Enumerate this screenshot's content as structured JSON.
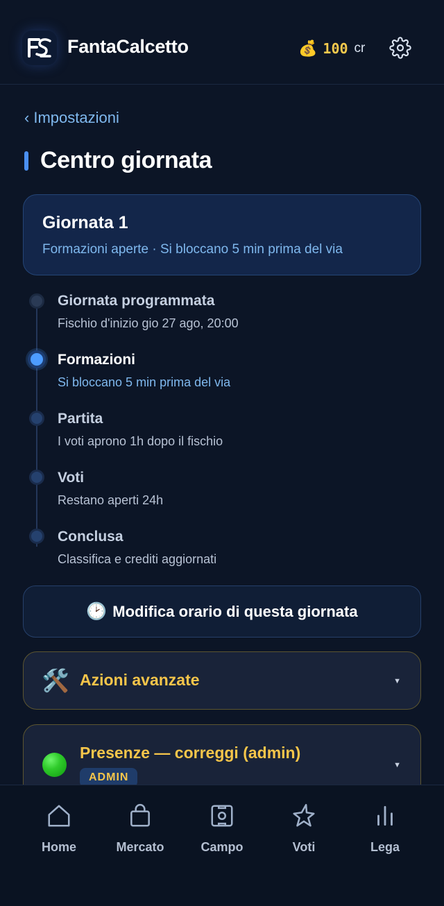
{
  "header": {
    "app_title": "FantaCalcetto",
    "credits_icon": "money-bag-icon",
    "credits_amount": "100",
    "credits_unit": "cr",
    "settings_icon": "gear-icon"
  },
  "breadcrumb": {
    "back_label": "Impostazioni"
  },
  "page": {
    "title": "Centro giornata"
  },
  "round": {
    "name": "Giornata 1",
    "status": "Formazioni aperte · Si bloccano 5 min prima del via"
  },
  "timeline": [
    {
      "label": "Giornata programmata",
      "sub": "Fischio d'inizio gio 27 ago, 20:00",
      "state": "done"
    },
    {
      "label": "Formazioni",
      "sub": "Si bloccano 5 min prima del via",
      "state": "active"
    },
    {
      "label": "Partita",
      "sub": "I voti aprono 1h dopo il fischio",
      "state": "pending"
    },
    {
      "label": "Voti",
      "sub": "Restano aperti 24h",
      "state": "pending"
    },
    {
      "label": "Conclusa",
      "sub": "Classifica e crediti aggiornati",
      "state": "pending"
    }
  ],
  "actions": {
    "edit_time_label": "Modifica orario di questa giornata",
    "advanced_label": "Azioni avanzate",
    "presence_label": "Presenze — correggi (admin)",
    "admin_badge": "ADMIN"
  },
  "nav": [
    {
      "label": "Home",
      "icon": "home-icon"
    },
    {
      "label": "Mercato",
      "icon": "shopping-bag-icon"
    },
    {
      "label": "Campo",
      "icon": "pitch-icon"
    },
    {
      "label": "Voti",
      "icon": "star-icon"
    },
    {
      "label": "Lega",
      "icon": "bar-chart-icon"
    }
  ],
  "colors": {
    "background": "#0c1526",
    "accent": "#4b8ff0",
    "link": "#7fb8ee",
    "gold": "#f5c54a"
  }
}
